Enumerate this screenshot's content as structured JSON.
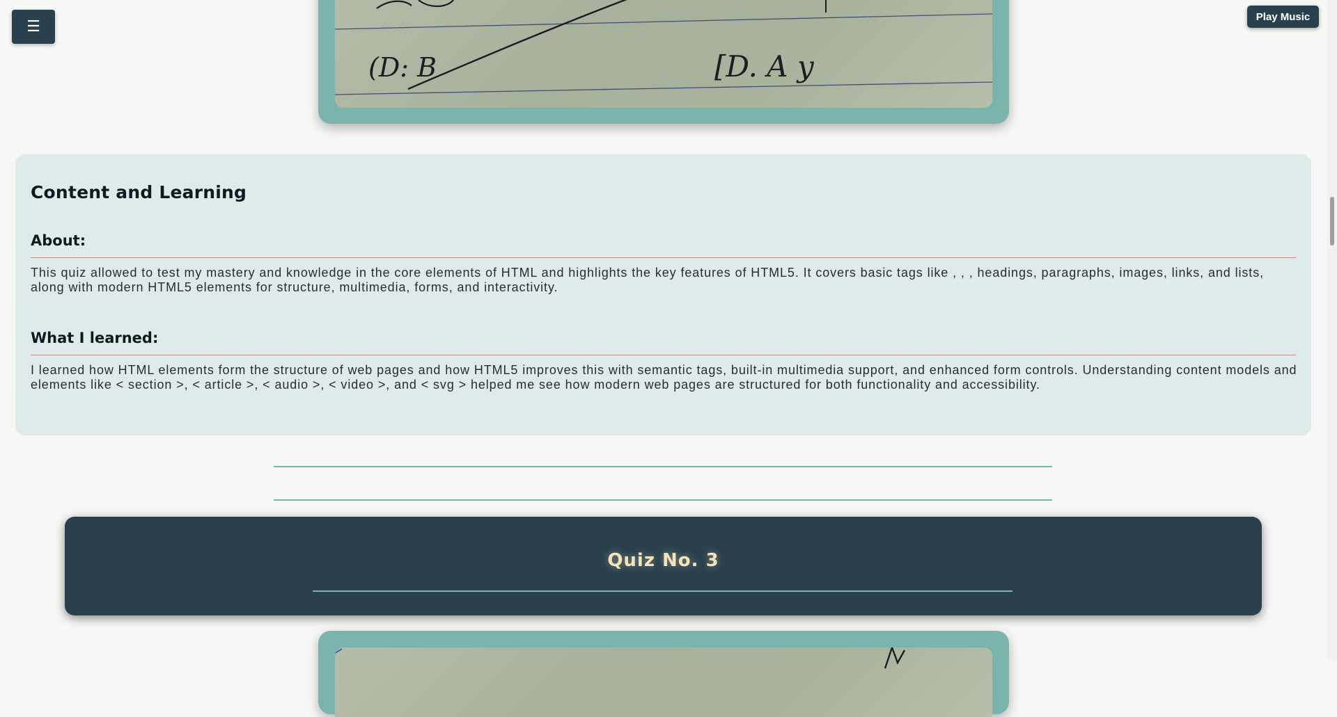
{
  "controls": {
    "menu_glyph": "☰",
    "play_music_label": "Play Music"
  },
  "top_image": {
    "handwriting": [
      "(D: B",
      "[D. A y"
    ]
  },
  "learning": {
    "title": "Content and Learning",
    "about_heading": "About:",
    "about_text": "This quiz allowed to test my mastery and knowledge in the core elements of HTML and highlights the key features of HTML5. It covers basic tags like , , , headings, paragraphs, images, links, and lists, along with modern HTML5 elements for structure, multimedia, forms, and interactivity.",
    "learned_heading": "What I learned:",
    "learned_text": "I learned how HTML elements form the structure of web pages and how HTML5 improves this with semantic tags, built-in multimedia support, and enhanced form controls. Understanding content models and elements like < section >, < article >, < audio >, < video >, and < svg > helped me see how modern web pages are structured for both functionality and accessibility."
  },
  "quiz": {
    "title": "Quiz No. 3"
  },
  "colors": {
    "dark_slate": "#29414c",
    "teal": "#7bb3ad",
    "panel_bg": "#dfebea",
    "quiz_title": "#f4e2b8",
    "rule_accent": "#b88f86"
  }
}
